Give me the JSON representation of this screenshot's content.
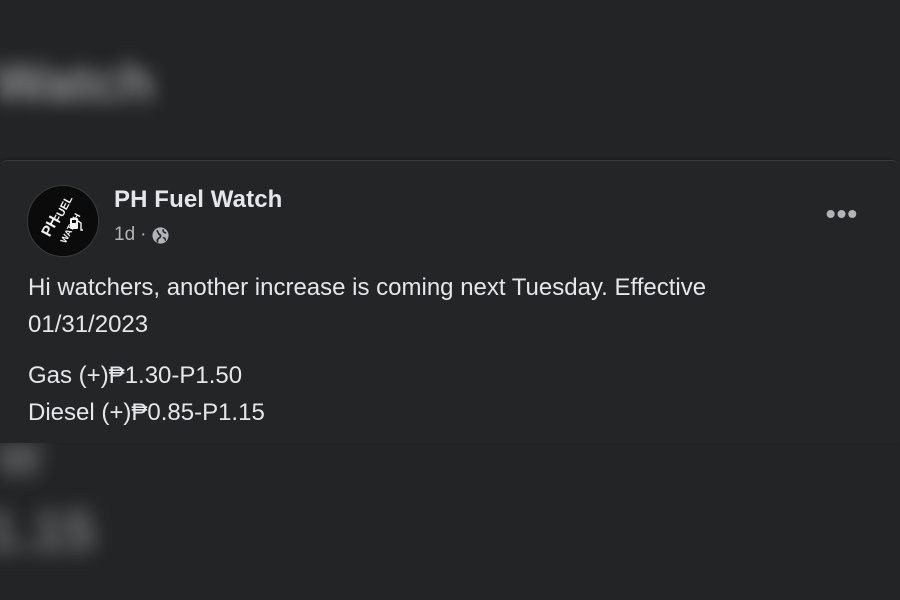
{
  "background": {
    "blurred_text_top": "Watch",
    "blurred_text_bottom_1": "W",
    "blurred_text_bottom_2": "1.15"
  },
  "post": {
    "author": "PH Fuel Watch",
    "timestamp": "1d",
    "separator": "·",
    "audience_icon": "globe-icon",
    "more_icon": "more-options-icon",
    "more_label": "•••",
    "avatar": {
      "text_line_1": "PH",
      "text_line_2": "FUEL",
      "text_line_3": "WATCH",
      "icon": "fuel-pump-icon"
    },
    "body": {
      "line_1": "Hi watchers, another increase is coming next Tuesday. Effective",
      "line_2": "01/31/2023",
      "line_3": "Gas (+)₱1.30-P1.50",
      "line_4": "Diesel (+)₱0.85-P1.15"
    }
  },
  "colors": {
    "background": "#232426",
    "card": "#242526",
    "primary_text": "#e4e6eb",
    "secondary_text": "#b0b3b8"
  }
}
